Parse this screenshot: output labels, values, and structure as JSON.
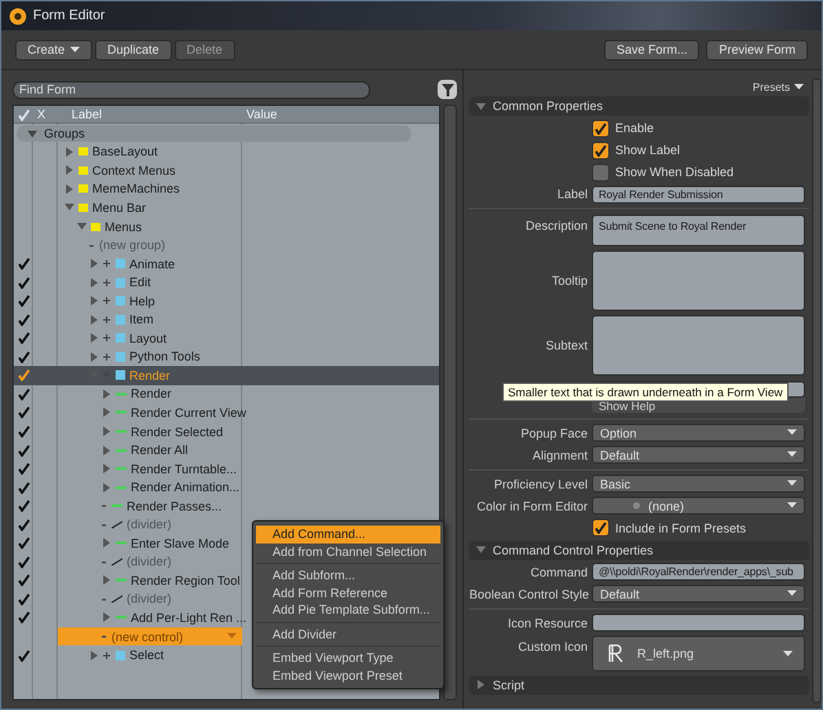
{
  "window": {
    "title": "Form Editor"
  },
  "toolbar": {
    "left": [
      {
        "label": "Create",
        "dropdown": true,
        "disabled": false
      },
      {
        "label": "Duplicate",
        "dropdown": false,
        "disabled": false
      },
      {
        "label": "Delete",
        "dropdown": false,
        "disabled": true
      }
    ],
    "right": [
      {
        "label": "Save Form...",
        "disabled": false
      },
      {
        "label": "Preview Form",
        "disabled": false
      }
    ]
  },
  "search": {
    "placeholder": "Find Form"
  },
  "tree": {
    "columns": [
      "X",
      "Label",
      "Value"
    ],
    "items": [
      {
        "label": "Groups",
        "kind": "group",
        "expanded": true,
        "children": [
          {
            "label": "BaseLayout",
            "kind": "folder",
            "expanded": false,
            "checked": false,
            "selected": false,
            "highlighted": false
          },
          {
            "label": "Context Menus",
            "kind": "folder",
            "expanded": false,
            "checked": false,
            "selected": false,
            "highlighted": false
          },
          {
            "label": "MemeMachines",
            "kind": "folder",
            "expanded": false,
            "checked": false,
            "selected": false,
            "highlighted": false
          },
          {
            "label": "Menu Bar",
            "kind": "folder",
            "expanded": true,
            "checked": false,
            "selected": false,
            "highlighted": false,
            "children": [
              {
                "label": "Menus",
                "kind": "folder",
                "expanded": true,
                "checked": false,
                "selected": false,
                "highlighted": false,
                "children": [
                  {
                    "label": "(new group)",
                    "kind": "placeholder",
                    "checked": false,
                    "selected": false,
                    "highlighted": false
                  },
                  {
                    "label": "Animate",
                    "kind": "menu",
                    "expanded": false,
                    "checked": true,
                    "selected": false,
                    "highlighted": false
                  },
                  {
                    "label": "Edit",
                    "kind": "menu",
                    "expanded": false,
                    "checked": true,
                    "selected": false,
                    "highlighted": false
                  },
                  {
                    "label": "Help",
                    "kind": "menu",
                    "expanded": false,
                    "checked": true,
                    "selected": false,
                    "highlighted": false
                  },
                  {
                    "label": "Item",
                    "kind": "menu",
                    "expanded": false,
                    "checked": true,
                    "selected": false,
                    "highlighted": false
                  },
                  {
                    "label": "Layout",
                    "kind": "menu",
                    "expanded": false,
                    "checked": true,
                    "selected": false,
                    "highlighted": false
                  },
                  {
                    "label": "Python Tools",
                    "kind": "menu",
                    "expanded": false,
                    "checked": true,
                    "selected": false,
                    "highlighted": false
                  },
                  {
                    "label": "Render",
                    "kind": "menu",
                    "expanded": true,
                    "checked": true,
                    "selected": true,
                    "highlighted": false,
                    "children": [
                      {
                        "label": "Render",
                        "kind": "command",
                        "expanded": false,
                        "checked": true,
                        "selected": false,
                        "highlighted": false
                      },
                      {
                        "label": "Render Current View",
                        "kind": "command",
                        "expanded": false,
                        "checked": true,
                        "selected": false,
                        "highlighted": false
                      },
                      {
                        "label": "Render Selected",
                        "kind": "command",
                        "expanded": false,
                        "checked": true,
                        "selected": false,
                        "highlighted": false
                      },
                      {
                        "label": "Render All",
                        "kind": "command",
                        "expanded": false,
                        "checked": true,
                        "selected": false,
                        "highlighted": false
                      },
                      {
                        "label": "Render Turntable...",
                        "kind": "command",
                        "expanded": false,
                        "checked": true,
                        "selected": false,
                        "highlighted": false
                      },
                      {
                        "label": "Render Animation...",
                        "kind": "command",
                        "expanded": false,
                        "checked": true,
                        "selected": false,
                        "highlighted": false
                      },
                      {
                        "label": "Render Passes...",
                        "kind": "command",
                        "checked": true,
                        "selected": false,
                        "highlighted": false
                      },
                      {
                        "label": "(divider)",
                        "kind": "divider",
                        "checked": true,
                        "selected": false,
                        "highlighted": false
                      },
                      {
                        "label": "Enter Slave Mode",
                        "kind": "command",
                        "expanded": false,
                        "checked": true,
                        "selected": false,
                        "highlighted": false
                      },
                      {
                        "label": "(divider)",
                        "kind": "divider",
                        "checked": true,
                        "selected": false,
                        "highlighted": false
                      },
                      {
                        "label": "Render Region Tool",
                        "kind": "command",
                        "expanded": false,
                        "checked": true,
                        "selected": false,
                        "highlighted": false
                      },
                      {
                        "label": "(divider)",
                        "kind": "divider",
                        "checked": true,
                        "selected": false,
                        "highlighted": false
                      },
                      {
                        "label": "Add Per-Light Ren ...",
                        "kind": "command",
                        "expanded": false,
                        "checked": true,
                        "selected": false,
                        "highlighted": false
                      },
                      {
                        "label": "(new control)",
                        "kind": "placeholder",
                        "checked": false,
                        "selected": false,
                        "highlighted": true
                      }
                    ]
                  },
                  {
                    "label": "Select",
                    "kind": "menu",
                    "expanded": false,
                    "checked": true,
                    "selected": false,
                    "highlighted": false
                  }
                ]
              }
            ]
          }
        ]
      }
    ]
  },
  "context_menu": {
    "sections": [
      [
        {
          "label": "Add Command...",
          "selected": true
        },
        {
          "label": "Add from Channel Selection",
          "selected": false
        }
      ],
      [
        {
          "label": "Add Subform...",
          "selected": false
        },
        {
          "label": "Add Form Reference",
          "selected": false
        },
        {
          "label": "Add Pie Template Subform...",
          "selected": false
        }
      ],
      [
        {
          "label": "Add Divider",
          "selected": false
        }
      ],
      [
        {
          "label": "Embed Viewport Type",
          "selected": false
        },
        {
          "label": "Embed Viewport Preset",
          "selected": false
        }
      ]
    ]
  },
  "properties": {
    "presets": "Presets",
    "sections": [
      {
        "title": "Common Properties",
        "expanded": true,
        "fields": [
          {
            "kind": "checkbox",
            "label": "Enable",
            "checked": true
          },
          {
            "kind": "checkbox",
            "label": "Show Label",
            "checked": true
          },
          {
            "kind": "checkbox",
            "label": "Show When Disabled",
            "checked": false
          },
          {
            "kind": "text",
            "label": "Label",
            "value": "Royal Render Submission"
          },
          {
            "kind": "divider"
          },
          {
            "kind": "textarea",
            "label": "Description",
            "value": "Submit Scene to Royal Render"
          },
          {
            "kind": "textarea_tall",
            "label": "Tooltip"
          },
          {
            "kind": "textarea_tall",
            "label": "Subtext"
          },
          {
            "kind": "help",
            "value": "Show Help"
          },
          {
            "kind": "divider"
          },
          {
            "kind": "dropdown",
            "label": "Popup Face",
            "value": "Option"
          },
          {
            "kind": "dropdown",
            "label": "Alignment",
            "value": "Default"
          },
          {
            "kind": "divider"
          },
          {
            "kind": "dropdown",
            "label": "Proficiency Level",
            "value": "Basic"
          },
          {
            "kind": "color",
            "label": "Color in Form Editor",
            "value": "(none)"
          },
          {
            "kind": "checkbox",
            "label": "Include in Form Presets",
            "checked": true
          }
        ]
      },
      {
        "title": "Command Control Properties",
        "expanded": true,
        "fields": [
          {
            "kind": "text",
            "label": "Command",
            "value": "@\\\\poldi\\RoyalRender\\render_apps\\_sub"
          },
          {
            "kind": "dropdown",
            "label": "Boolean Control Style",
            "value": "Default"
          },
          {
            "kind": "divider"
          },
          {
            "kind": "text",
            "label": "Icon Resource"
          },
          {
            "kind": "icon",
            "label": "Custom Icon",
            "value": "R_left.png"
          }
        ]
      },
      {
        "title": "Script",
        "expanded": false
      }
    ]
  },
  "tooltip": "Smaller text that is drawn underneath in a Form View"
}
